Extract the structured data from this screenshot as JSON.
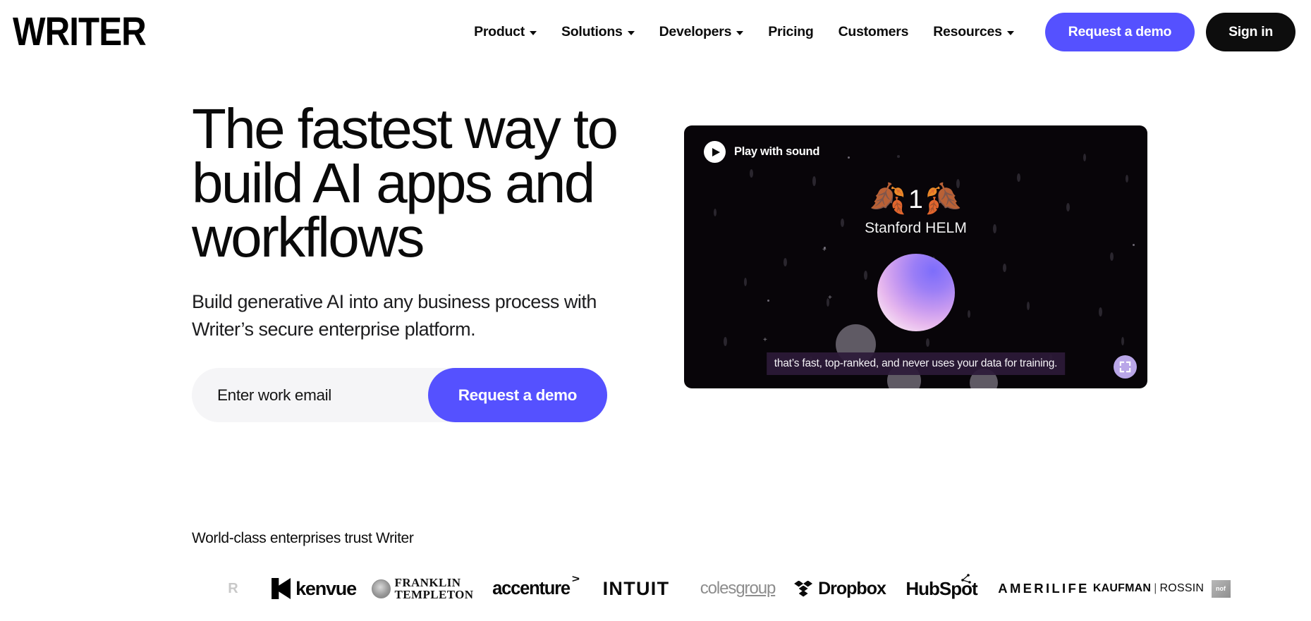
{
  "brand": {
    "logo_text": "WRITER",
    "accent": "#5551ff",
    "dark": "#0d0d0d"
  },
  "nav": {
    "links": [
      {
        "label": "Product",
        "has_caret": true
      },
      {
        "label": "Solutions",
        "has_caret": true
      },
      {
        "label": "Developers",
        "has_caret": true
      },
      {
        "label": "Pricing",
        "has_caret": false
      },
      {
        "label": "Customers",
        "has_caret": false
      },
      {
        "label": "Resources",
        "has_caret": true
      }
    ],
    "demo_button": "Request a demo",
    "signin_button": "Sign in"
  },
  "hero": {
    "headline": "The fastest way to build AI apps and workflows",
    "subhead": "Build generative AI into any business process with Writer’s secure enterprise platform.",
    "email_placeholder": "Enter work email",
    "email_value": "",
    "submit_label": "Request a demo"
  },
  "video": {
    "play_label": "Play with sound",
    "award_number": "1",
    "award_name": "Stanford HELM",
    "caption": "that’s fast, top-ranked, and never uses your data for training.",
    "fullscreen_icon": "fullscreen-icon",
    "background_color": "#080509",
    "caption_bg": "#2d1a38"
  },
  "trust": {
    "heading": "World-class enterprises trust Writer",
    "logos": [
      {
        "name": "r-logo",
        "text": "R"
      },
      {
        "name": "kenvue",
        "text": "kenvue"
      },
      {
        "name": "franklin-templeton",
        "line1": "FRANKLIN",
        "line2": "TEMPLETON"
      },
      {
        "name": "accenture",
        "text": "accenture"
      },
      {
        "name": "intuit",
        "text": "INTUIT"
      },
      {
        "name": "coles-group",
        "text1": "coles",
        "text2": "group"
      },
      {
        "name": "dropbox",
        "text": "Dropbox"
      },
      {
        "name": "hubspot",
        "text": "HubSpot"
      },
      {
        "name": "amerilife",
        "text": "AMERILIFE"
      },
      {
        "name": "kaufman-rossin",
        "text1": "KAUFMAN",
        "text2": "ROSSIN"
      },
      {
        "name": "nof",
        "text": "nof"
      }
    ]
  }
}
